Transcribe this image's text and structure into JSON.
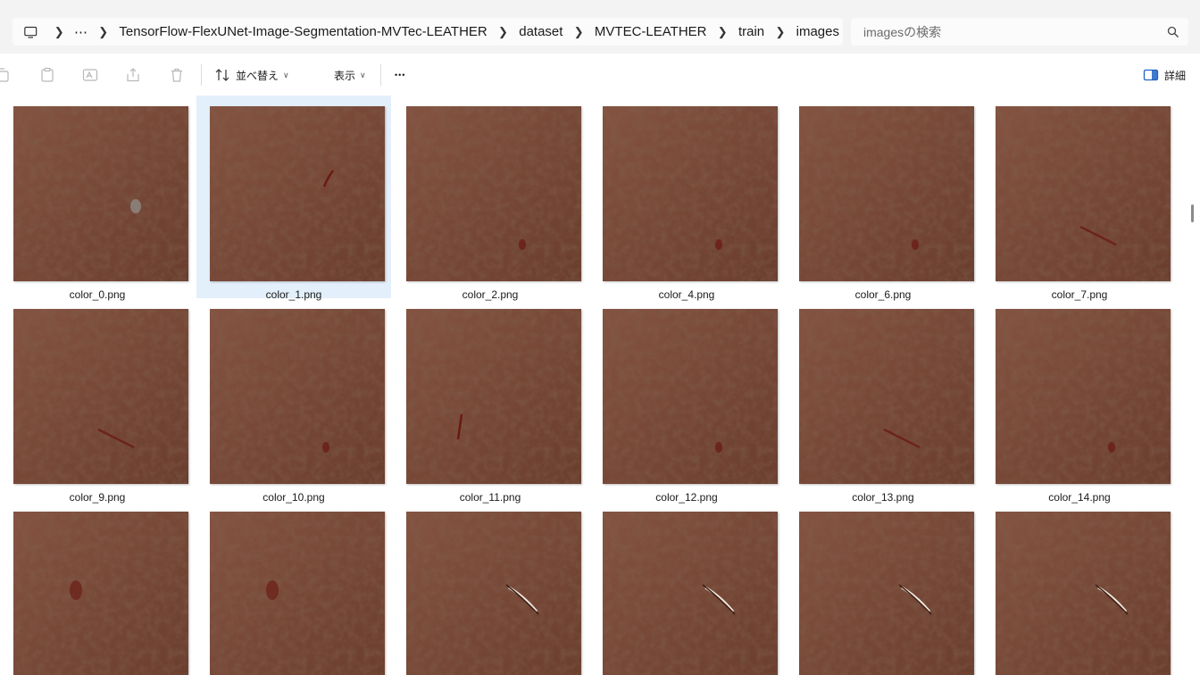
{
  "address_bar": {
    "pc_icon": "computer-icon",
    "overflow": "⋯",
    "crumbs": [
      "TensorFlow-FlexUNet-Image-Segmentation-MVTec-LEATHER",
      "dataset",
      "MVTEC-LEATHER",
      "train",
      "images"
    ]
  },
  "search": {
    "placeholder": "imagesの検索",
    "icon": "search-icon"
  },
  "toolbar": {
    "sort_label": "並べ替え",
    "view_label": "表示",
    "more_label": "•••",
    "details_label": "詳細",
    "icons": [
      "copy-icon",
      "paste-icon",
      "rename-icon",
      "share-icon",
      "delete-icon",
      "sort-icon",
      "details-pane-icon"
    ]
  },
  "colors": {
    "leather": "#7a4a38",
    "selection": "#e3effb",
    "defect": "#6a1a14"
  },
  "files": [
    {
      "name": "color_0.png",
      "defect": "gray"
    },
    {
      "name": "color_1.png",
      "defect": "crack",
      "selected": true
    },
    {
      "name": "color_2.png",
      "defect": "spot"
    },
    {
      "name": "color_4.png",
      "defect": "spot"
    },
    {
      "name": "color_6.png",
      "defect": "spot"
    },
    {
      "name": "color_7.png",
      "defect": "streak"
    },
    {
      "name": "color_9.png",
      "defect": "streak"
    },
    {
      "name": "color_10.png",
      "defect": "spot"
    },
    {
      "name": "color_11.png",
      "defect": "vertical"
    },
    {
      "name": "color_12.png",
      "defect": "spot"
    },
    {
      "name": "color_13.png",
      "defect": "streak"
    },
    {
      "name": "color_14.png",
      "defect": "spot"
    },
    {
      "name": "",
      "defect": "blob"
    },
    {
      "name": "",
      "defect": "blob"
    },
    {
      "name": "",
      "defect": "cut"
    },
    {
      "name": "",
      "defect": "cut"
    },
    {
      "name": "",
      "defect": "cut"
    },
    {
      "name": "",
      "defect": "cut"
    }
  ]
}
